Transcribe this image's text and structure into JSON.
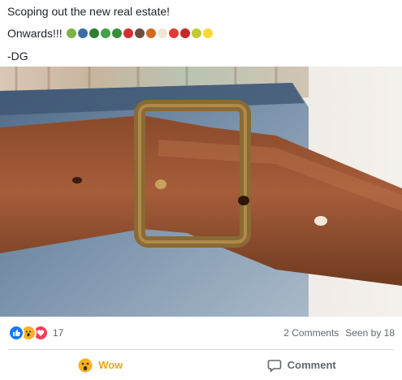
{
  "post": {
    "line1": "Scoping out the new real estate!",
    "line2": "Onwards!!!",
    "line3": "-DG",
    "emojis": [
      {
        "name": "salad-emoji",
        "color": "#7cb342"
      },
      {
        "name": "bowl-emoji",
        "color": "#3b6ea5"
      },
      {
        "name": "leafy-greens-emoji",
        "color": "#2e7d32"
      },
      {
        "name": "cucumber-emoji",
        "color": "#43a047"
      },
      {
        "name": "broccoli-emoji",
        "color": "#388e3c"
      },
      {
        "name": "hot-pepper-emoji",
        "color": "#d32f2f"
      },
      {
        "name": "chestnut-emoji",
        "color": "#6d4c41"
      },
      {
        "name": "drumstick-emoji",
        "color": "#d2691e"
      },
      {
        "name": "egg-emoji",
        "color": "#f3e5d0"
      },
      {
        "name": "tomato-emoji",
        "color": "#e53935"
      },
      {
        "name": "cherries-emoji",
        "color": "#c62828"
      },
      {
        "name": "green-apple-emoji",
        "color": "#c0ca33"
      },
      {
        "name": "lemon-emoji",
        "color": "#fdd835"
      }
    ]
  },
  "stats": {
    "reaction_count": "17",
    "comments": "2 Comments",
    "seen_by": "Seen by 18"
  },
  "actions": {
    "wow_label": "Wow",
    "comment_label": "Comment"
  },
  "colors": {
    "like": "#1877f2",
    "wow": "#f7b125",
    "love": "#f33e58",
    "wow_text": "#e6a817"
  }
}
